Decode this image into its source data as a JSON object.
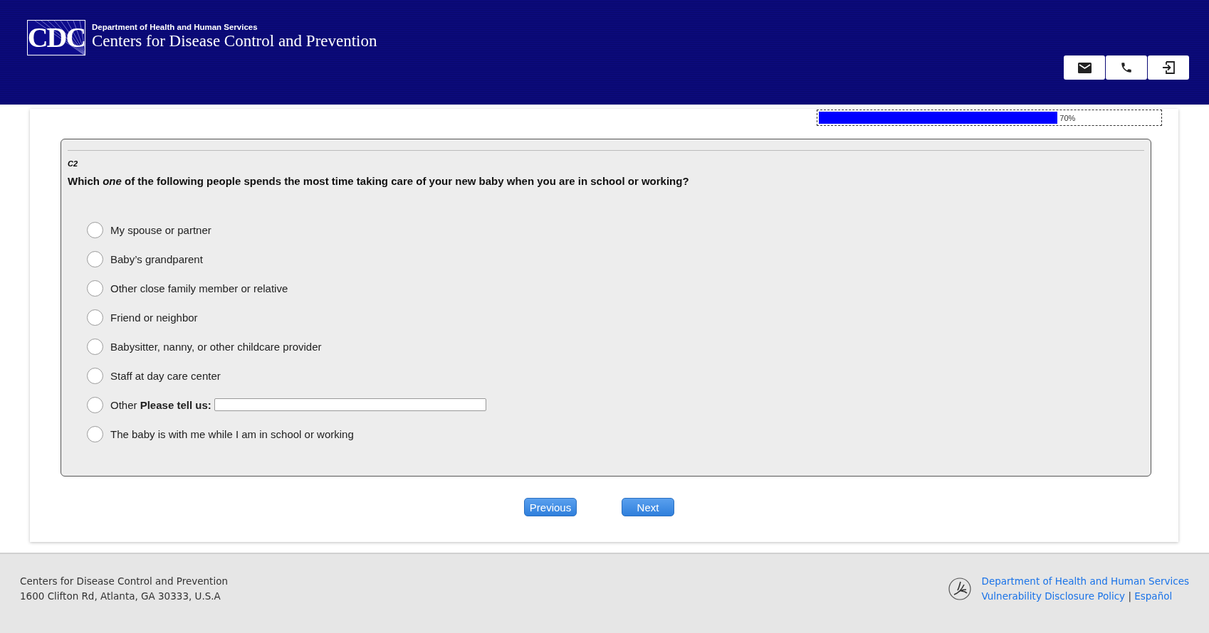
{
  "header": {
    "logo_text": "CDC",
    "department": "Department of Health and Human Services",
    "agency": "Centers for Disease Control and Prevention",
    "buttons": [
      {
        "kind": "mail"
      },
      {
        "kind": "phone"
      },
      {
        "kind": "exit"
      }
    ]
  },
  "progress": {
    "level": 0.7,
    "reading": "70%"
  },
  "question": {
    "code": "C2",
    "text": "Which *one* of the following people spends the most time taking care of your new baby when you are in school or working?",
    "options": [
      {
        "kind": "plain",
        "label": "My spouse or partner",
        "selected": false
      },
      {
        "kind": "plain",
        "label": "Baby’s grandparent",
        "selected": false
      },
      {
        "kind": "plain",
        "label": "Other close family member or relative",
        "selected": false
      },
      {
        "kind": "plain",
        "label": "Friend or neighbor",
        "selected": false
      },
      {
        "kind": "plain",
        "label": "Babysitter, nanny, or other childcare provider",
        "selected": false
      },
      {
        "kind": "plain",
        "label": "Staff at day care center",
        "selected": false
      },
      {
        "kind": "text_entry",
        "label": "Other **Please tell us:**",
        "selected": false
      },
      {
        "kind": "plain",
        "label": "The baby is with me while I am in school or working",
        "selected": false
      }
    ]
  },
  "navigation": [
    "Previous",
    "Next"
  ],
  "footer": {
    "address": [
      "Centers for Disease Control and Prevention",
      "1600 Clifton Rd, Atlanta, GA 30333, U.S.A"
    ],
    "agency_link": "Department of Health and Human Services",
    "links": [
      "Vulnerability Disclosure Policy",
      "Español"
    ],
    "separator": "|"
  }
}
